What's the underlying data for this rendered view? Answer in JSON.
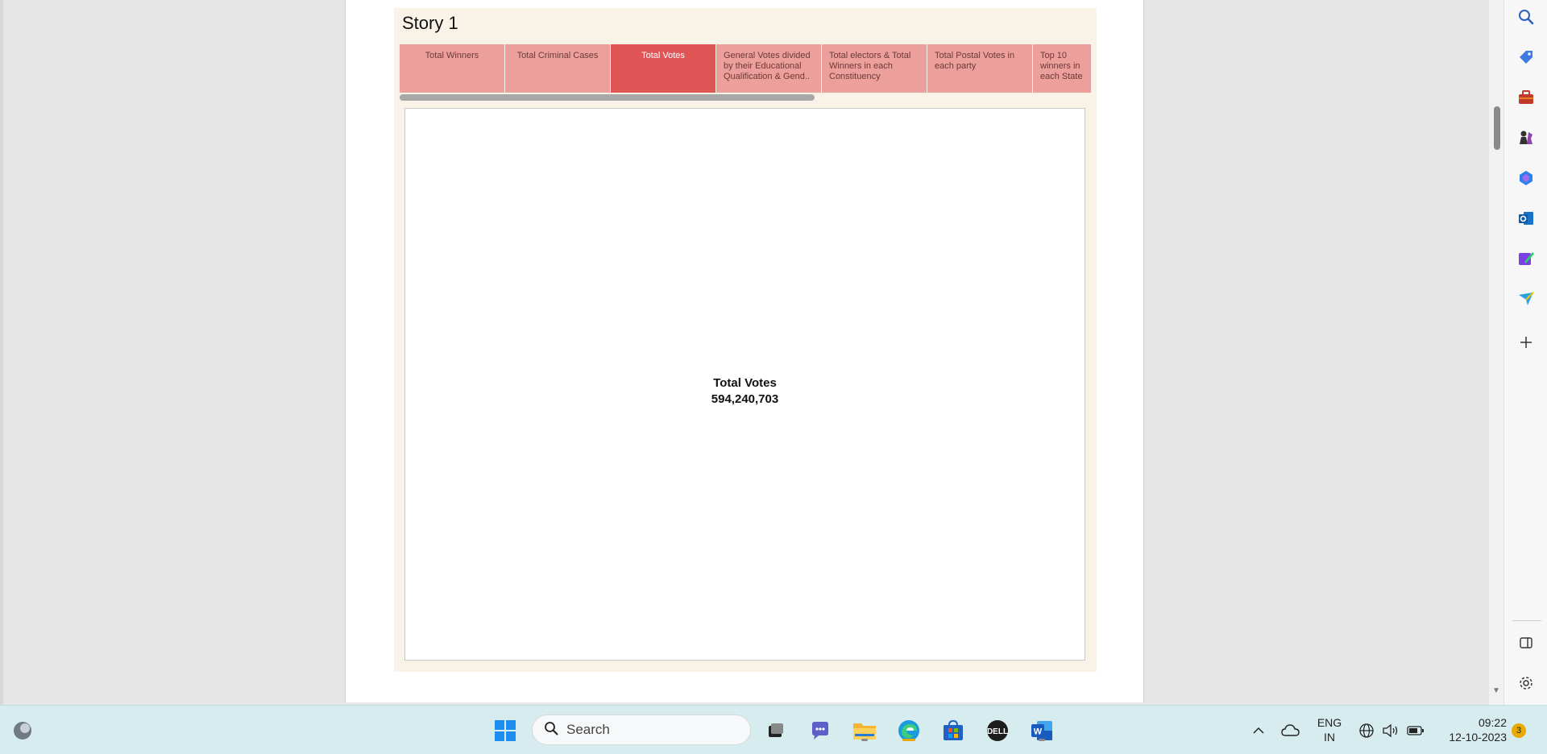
{
  "story": {
    "title": "Story 1",
    "tabs": [
      {
        "label": "Total Winners",
        "active": false
      },
      {
        "label": "Total Criminal Cases",
        "active": false
      },
      {
        "label": "Total Votes",
        "active": true
      },
      {
        "label": "General Votes divided by their Educational Qualification & Gend..",
        "active": false
      },
      {
        "label": "Total electors & Total Winners in each Constituency",
        "active": false
      },
      {
        "label": "Total Postal Votes in each party",
        "active": false
      },
      {
        "label": "Top 10 winners in each State",
        "active": false
      }
    ],
    "kpi": {
      "label": "Total Votes",
      "value": "594,240,703"
    }
  },
  "edge_sidebar": {
    "icons": [
      "search-icon",
      "tag-icon",
      "toolbox-icon",
      "chess-icon",
      "copilot-icon",
      "outlook-icon",
      "designer-icon",
      "send-icon",
      "add-icon",
      "split-view-icon",
      "settings-icon"
    ]
  },
  "taskbar": {
    "search_placeholder": "Search",
    "language_line1": "ENG",
    "language_line2": "IN",
    "time": "09:22",
    "date": "12-10-2023",
    "notification_count": "3"
  },
  "colors": {
    "tab_inactive": "#ec9f9b",
    "tab_active": "#e05656",
    "story_background": "#f9f3e7",
    "taskbar": "#d7ecef"
  }
}
